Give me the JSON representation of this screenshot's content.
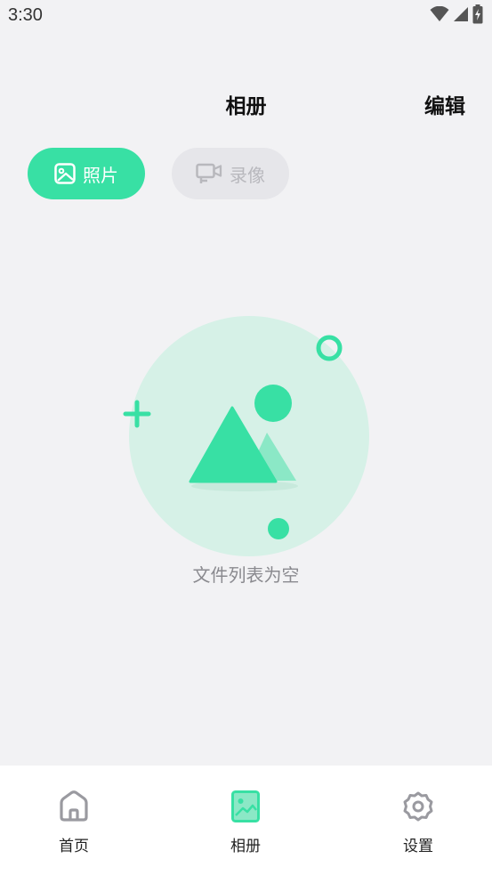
{
  "status_bar": {
    "time": "3:30",
    "icons": [
      "wifi-icon",
      "signal-icon",
      "battery-charging-icon"
    ]
  },
  "header": {
    "title": "相册",
    "edit_label": "编辑"
  },
  "tabs": [
    {
      "label": "照片",
      "icon": "image-icon",
      "active": true
    },
    {
      "label": "录像",
      "icon": "video-camera-icon",
      "active": false
    }
  ],
  "empty_state": {
    "icon": "empty-gallery-illustration",
    "message": "文件列表为空"
  },
  "bottom_nav": [
    {
      "label": "首页",
      "icon": "home-icon",
      "active": false
    },
    {
      "label": "相册",
      "icon": "album-icon",
      "active": true
    },
    {
      "label": "设置",
      "icon": "gear-icon",
      "active": false
    }
  ],
  "colors": {
    "accent": "#38e0a4",
    "accent_light": "#d6f1e7",
    "background": "#f2f2f4",
    "inactive_tab": "#e6e6ea",
    "inactive_text": "#b8b8bd",
    "nav_icon_inactive": "#9a9aa0"
  }
}
